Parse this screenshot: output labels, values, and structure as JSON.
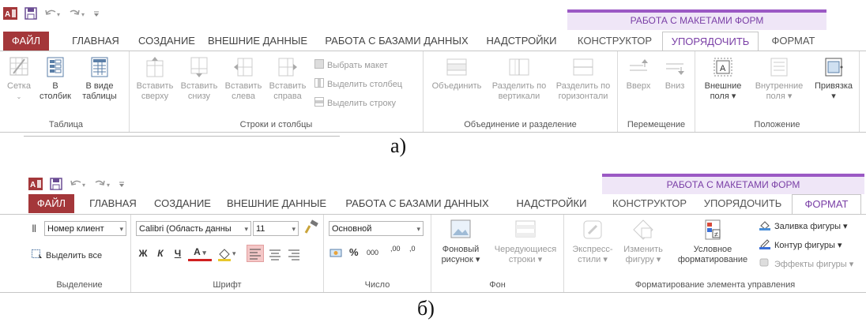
{
  "ribbon_a": {
    "qat": {
      "app_icon": "access-icon",
      "save_icon": "save-icon",
      "undo_icon": "undo-icon",
      "redo_icon": "redo-icon",
      "customize_icon": "customize-qat-icon"
    },
    "context_header": "РАБОТА С МАКЕТАМИ ФОРМ",
    "tabs": {
      "file": "ФАЙЛ",
      "home": "ГЛАВНАЯ",
      "create": "СОЗДАНИЕ",
      "external": "ВНЕШНИЕ ДАННЫЕ",
      "database": "РАБОТА С БАЗАМИ ДАННЫХ",
      "addins": "НАДСТРОЙКИ",
      "design": "КОНСТРУКТОР",
      "arrange": "УПОРЯДОЧИТЬ",
      "format": "ФОРМАТ"
    },
    "groups": {
      "table": {
        "label": "Таблица",
        "grid": "Сетка",
        "stacked_1": "В",
        "stacked_2": "столбик",
        "tabular_1": "В виде",
        "tabular_2": "таблицы"
      },
      "rows_cols": {
        "label": "Строки и столбцы",
        "above_1": "Вставить",
        "above_2": "сверху",
        "below_1": "Вставить",
        "below_2": "снизу",
        "left_1": "Вставить",
        "left_2": "слева",
        "right_1": "Вставить",
        "right_2": "справа",
        "select_layout": "Выбрать макет",
        "select_column": "Выделить столбец",
        "select_row": "Выделить строку"
      },
      "merge": {
        "label": "Объединение и разделение",
        "merge": "Объединить",
        "split_v_1": "Разделить по",
        "split_v_2": "вертикали",
        "split_h_1": "Разделить по",
        "split_h_2": "горизонтали"
      },
      "move": {
        "label": "Перемещение",
        "up": "Вверх",
        "down": "Вниз"
      },
      "position": {
        "label": "Положение",
        "outer_1": "Внешние",
        "outer_2": "поля ▾",
        "inner_1": "Внутренние",
        "inner_2": "поля ▾",
        "anchor_1": "Привязка",
        "anchor_2": "▾"
      }
    },
    "caption": "а)"
  },
  "ribbon_b": {
    "context_header": "РАБОТА С МАКЕТАМИ ФОРМ",
    "tabs": {
      "file": "ФАЙЛ",
      "home": "ГЛАВНАЯ",
      "create": "СОЗДАНИЕ",
      "external": "ВНЕШНИЕ ДАННЫЕ",
      "database": "РАБОТА С БАЗАМИ ДАННЫХ",
      "addins": "НАДСТРОЙКИ",
      "design": "КОНСТРУКТОР",
      "arrange": "УПОРЯДОЧИТЬ",
      "format": "ФОРМАТ"
    },
    "groups": {
      "selection": {
        "label": "Выделение",
        "object_combo": "Номер клиент",
        "select_all": "Выделить все"
      },
      "font": {
        "label": "Шрифт",
        "font_name": "Calibri (Область данны",
        "font_size": "11",
        "bold": "Ж",
        "italic": "К",
        "underline": "Ч",
        "font_color": "А"
      },
      "number": {
        "label": "Число",
        "format": "Основной",
        "percent": "%",
        "thousands": "000",
        "inc_dec": ",00",
        "dec_dec": ",0"
      },
      "background": {
        "label": "Фон",
        "bg_image_1": "Фоновый",
        "bg_image_2": "рисунок ▾",
        "alt_rows_1": "Чередующиеся",
        "alt_rows_2": "строки ▾"
      },
      "control_format": {
        "label": "Форматирование элемента управления",
        "quick_styles_1": "Экспресс-",
        "quick_styles_2": "стили ▾",
        "change_shape_1": "Изменить",
        "change_shape_2": "фигуру ▾",
        "conditional_1": "Условное",
        "conditional_2": "форматирование",
        "shape_fill": "Заливка фигуры ▾",
        "shape_outline": "Контур фигуры ▾",
        "shape_effects": "Эффекты фигуры ▾"
      }
    },
    "caption": "б)"
  },
  "colors": {
    "file_tab": "#a4373a",
    "context_accent": "#9b59c4",
    "context_bg": "#efe6f7",
    "highlight": "#f4c7c7"
  }
}
